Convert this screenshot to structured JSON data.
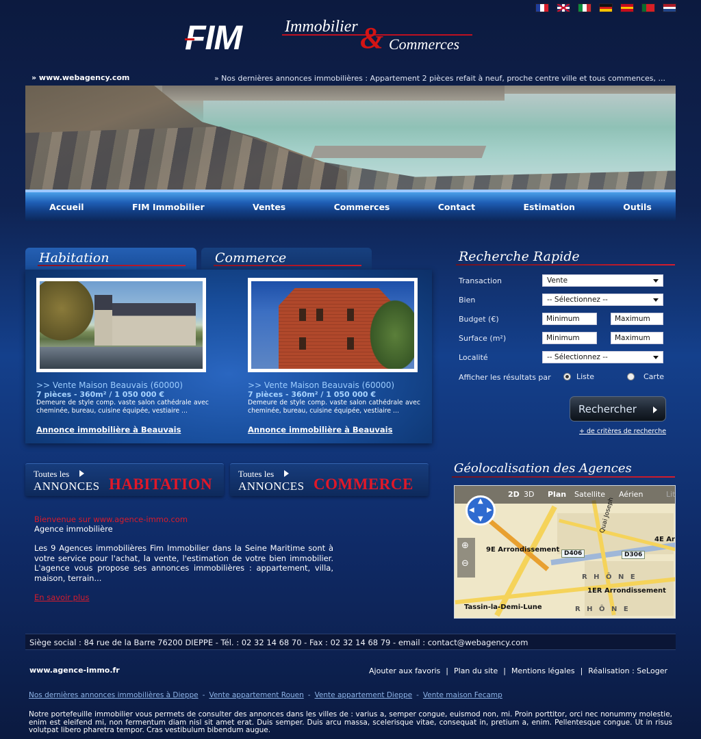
{
  "flags": [
    {
      "name": "flag-france-icon",
      "colors": [
        "#1f3e9c",
        "#ffffff",
        "#d81c2c"
      ],
      "dir": "v"
    },
    {
      "name": "flag-uk-icon",
      "colors": [
        "#21306e",
        "#ffffff",
        "#c8102e"
      ],
      "dir": "uk"
    },
    {
      "name": "flag-italy-icon",
      "colors": [
        "#0b8d3f",
        "#ffffff",
        "#cf2a32"
      ],
      "dir": "v"
    },
    {
      "name": "flag-germany-icon",
      "colors": [
        "#111111",
        "#d11b1b",
        "#f5c400"
      ],
      "dir": "h"
    },
    {
      "name": "flag-spain-icon",
      "colors": [
        "#c60b1e",
        "#ffc400",
        "#c60b1e"
      ],
      "dir": "h"
    },
    {
      "name": "flag-portugal-icon",
      "colors": [
        "#0a6c2e",
        "#d61f26",
        "#d61f26"
      ],
      "dir": "v"
    },
    {
      "name": "flag-netherlands-icon",
      "colors": [
        "#ae1c28",
        "#ffffff",
        "#21468b"
      ],
      "dir": "h"
    }
  ],
  "logo": {
    "fim": "FIM",
    "immobilier": "Immobilier",
    "amp": "&",
    "commerces": "Commerces"
  },
  "ticker": {
    "site": "» www.webagency.com",
    "news": "» Nos dernières annonces immobilières : Appartement 2 pièces refait à neuf, proche centre ville et tous commences, ..."
  },
  "nav": [
    "Accueil",
    "FIM Immobilier",
    "Ventes",
    "Commerces",
    "Contact",
    "Estimation",
    "Outils"
  ],
  "tabs": {
    "habitation": "Habitation",
    "commerce": "Commerce"
  },
  "cards": [
    {
      "title": ">> Vente Maison Beauvais (60000)",
      "sub": "7 pièces - 360m² / 1 050 000 €",
      "desc": "Demeure de style comp. vaste salon cathédrale avec cheminée, bureau, cuisine équipée, vestiaire ...",
      "link": "Annonce immobilière à Beauvais"
    },
    {
      "title": ">> Vente Maison Beauvais (60000)",
      "sub": "7 pièces - 360m² / 1 050 000 €",
      "desc": "Demeure de style comp. vaste salon cathédrale avec cheminée, bureau, cuisine équipée, vestiaire ...",
      "link": "Annonce immobilière à Beauvais"
    }
  ],
  "search": {
    "title": "Recherche Rapide",
    "transaction_label": "Transaction",
    "transaction_value": "Vente",
    "bien_label": "Bien",
    "bien_value": "-- Sélectionnez --",
    "budget_label": "Budget (€)",
    "budget_min": "Minimum",
    "budget_max": "Maximum",
    "surface_label": "Surface (m²)",
    "surface_min": "Minimum",
    "surface_max": "Maximum",
    "localite_label": "Localité",
    "localite_value": "-- Sélectionnez --",
    "display_label": "Afficher les résultats par",
    "option_liste": "Liste",
    "option_carte": "Carte",
    "button": "Rechercher",
    "more": "+ de critères de recherche"
  },
  "annonces": [
    {
      "line1": "Toutes les",
      "line2": "ANNONCES",
      "line3": "HABITATION"
    },
    {
      "line1": "Toutes les",
      "line2": "ANNONCES",
      "line3": "COMMERCE"
    }
  ],
  "welcome": {
    "title": "Bienvenue sur www.agence-immo.com",
    "subtitle": "Agence immobilière",
    "body": "Les 9 Agences immobilières Fim Immobilier dans la Seine Maritime sont à votre service pour l'achat, la vente, l'estimation de votre bien immobilier. L'agence vous propose ses annonces immobilières : appartement, villa, maison, terrain...",
    "more": "En savoir plus"
  },
  "geo": {
    "title": "Géolocalisation des Agences",
    "map_tabs": [
      "2D",
      "3D",
      "Plan",
      "Satellite",
      "Aérien",
      "Lit"
    ],
    "labels": {
      "arr9": "9E Arrondissement",
      "arr4": "4E Ar",
      "arr1": "1ER Arrondissement",
      "tassin": "Tassin-la-Demi-Lune",
      "rhone1": "R H Ô N E",
      "rhone2": "R H Ô N E",
      "d406": "D406",
      "d306": "D306",
      "quai": "Quai Joseph"
    }
  },
  "footer": {
    "address": "Siège social : 84 rue de la Barre 76200 DIEPPE  - Tél. : 02 32 14 68 70 - Fax : 02 32 14 68 79 - email : contact@webagency.com",
    "site": "www.agence-immo.fr",
    "links": [
      "Ajouter aux favoris",
      "Plan du site",
      "Mentions légales",
      "Réalisation : SeLoger"
    ],
    "seo": [
      "Nos dernières annonces immobilières à Dieppe",
      "Vente appartement Rouen",
      "Vente appartement Dieppe",
      "Vente maison Fecamp"
    ],
    "lorem": "Notre portefeuille immobilier vous permets de consulter des annonces dans les villes de : varius a, semper congue, euismod non, mi. Proin porttitor, orci nec nonummy molestie, enim est eleifend mi, non fermentum diam nisl sit amet erat. Duis semper. Duis arcu massa, scelerisque vitae, consequat in, pretium a, enim. Pellentesque congue. Ut in risus volutpat libero pharetra tempor. Cras vestibulum bibendum augue."
  }
}
